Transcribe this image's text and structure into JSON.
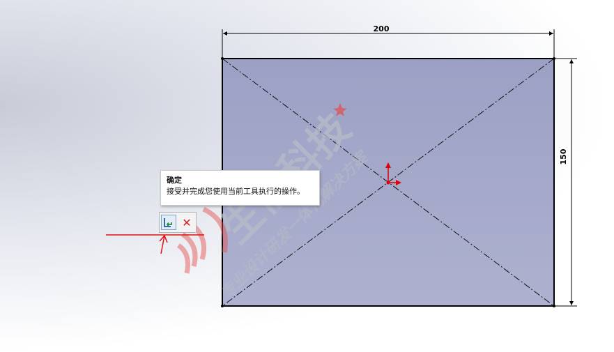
{
  "sketch": {
    "width_dimension": "200",
    "height_dimension": "150",
    "fill_color": "#9b9fc4",
    "origin_color": "#e00000"
  },
  "tooltip": {
    "title": "确定",
    "description": "接受并完成您使用当前工具执行的操作。"
  },
  "confirm_corner": {
    "ok_icon": "confirm-check-icon",
    "cancel_icon": "cancel-x-icon"
  },
  "watermark": {
    "main": "生信科技",
    "sub": "专业设计研发一体化解决方案"
  },
  "colors": {
    "annotation_red": "#e01010",
    "watermark_red": "#e54a4a"
  }
}
